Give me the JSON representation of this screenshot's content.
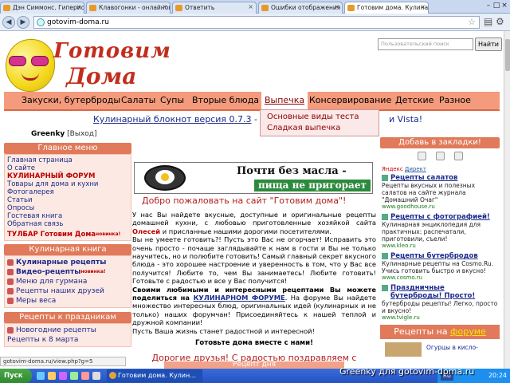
{
  "browser": {
    "tabs": [
      {
        "label": "Дэн Симмонс. Гиперион"
      },
      {
        "label": "Клавогонки - онлайновы"
      },
      {
        "label": "Ответить"
      },
      {
        "label": "Ошибки отображения са"
      },
      {
        "label": "Готовим дома. Кулинар"
      }
    ],
    "address": "gotovim-doma.ru",
    "status_url": "gotovim-doma.ru/view.php?g=5"
  },
  "site": {
    "logo_line1": "Готовим",
    "logo_line2": "Дома",
    "search_placeholder": "Пользовательский поиск",
    "search_button": "Найти",
    "nav": [
      {
        "label": "Закуски, бутерброды"
      },
      {
        "label": "Салаты"
      },
      {
        "label": "Супы"
      },
      {
        "label": "Вторые блюда"
      },
      {
        "label": "Выпечка"
      },
      {
        "label": "Консервирование"
      },
      {
        "label": "Детские"
      },
      {
        "label": "Разное"
      }
    ],
    "dropdown": [
      "Основные виды теста",
      "Сладкая выпечка"
    ],
    "notebook_text": "Кулинарный блокнот версия 0.7.3",
    "notebook_tail": "- co",
    "notebook_end": "и Vista!"
  },
  "left": {
    "username": "Greenky",
    "logout": "[Выход]",
    "main_menu_title": "Главное меню",
    "main_menu": [
      {
        "label": "Главная страница",
        "bold": false,
        "sup": ""
      },
      {
        "label": "О сайте",
        "bold": false,
        "sup": ""
      },
      {
        "label": "КУЛИНАРНЫЙ ФОРУМ",
        "bold": true,
        "sup": ""
      },
      {
        "label": "Товары для дома и кухни",
        "bold": false,
        "sup": ""
      },
      {
        "label": "Фотогалерея",
        "bold": false,
        "sup": ""
      },
      {
        "label": "Статьи",
        "bold": false,
        "sup": ""
      },
      {
        "label": "Опросы",
        "bold": false,
        "sup": ""
      },
      {
        "label": "Гостевая книга",
        "bold": false,
        "sup": ""
      },
      {
        "label": "Обратная связь",
        "bold": false,
        "sup": ""
      },
      {
        "label": "ТУЛБАР Готовим Дома",
        "bold": true,
        "sup": "новинка!"
      }
    ],
    "cookbook_title": "Кулинарная книга",
    "cookbook": [
      {
        "label": "Кулинарные рецепты",
        "bold": true,
        "sup": ""
      },
      {
        "label": "Видео-рецепты",
        "bold": true,
        "sup": "новинка!"
      },
      {
        "label": "Меню для гурмана",
        "bold": false,
        "sup": ""
      },
      {
        "label": "Рецепты наших друзей",
        "bold": false,
        "sup": ""
      },
      {
        "label": "Меры веса",
        "bold": false,
        "sup": ""
      }
    ],
    "holiday_title": "Рецепты к праздникам",
    "holiday": [
      {
        "label": "Новогодние рецепты"
      },
      {
        "label": "Рецепты к 8 марта"
      }
    ]
  },
  "center": {
    "banner_line1": "Почти без масла  -",
    "banner_line2": "пища не пригорает",
    "welcome": "Добро пожаловать на сайт \"Готовим дома\"!",
    "p1": "У нас Вы найдете вкусные, доступные и оригинальные рецепты домашней кухни, с любовью приготовленные хозяйкой сайта ",
    "olesya": "Олесей",
    "p1b": " и присланные нашими дорогими посетителями.",
    "p2": "Вы не умеете готовить?! Пусть это Вас не огорчает! Исправить это очень просто - почаще заглядывайте к нам в гости и Вы не только научитесь, но и полюбите готовить! Самый главный секрет вкусного блюда - это хорошее настроение и уверенность в том, что у Вас все получится! Любите то, чем Вы занимаетесь! Любите готовить! Готовьте с радостью и все у Вас получится!",
    "p3a": "Своими любимыми и интересными рецептами Вы можете поделиться на ",
    "forum_link": "КУЛИНАРНОМ ФОРУМЕ",
    "p3b": ". На форуме Вы найдете множество интересных блюд, оригинальных идей (кулинарных и не только) наших форумчан! Присоединяйтесь к нашей теплой и дружной компании!",
    "p4": "Пусть Ваша жизнь станет радостной и интересной!",
    "together": "Готовьте дома вместе с нами!",
    "greet": "Дорогие друзья! С радостью поздравляем с началом Успенского поста!",
    "recipe_day": "Рецепт дня"
  },
  "right": {
    "bookmarks_title": "Добавь в закладки!",
    "yandex_label": "Яндекс",
    "yandex_direct": "Директ",
    "ads": [
      {
        "title": "Рецепты салатов",
        "text": "Рецепты вкусных и полезных салатов на сайте журнала \"Домашний Очаг\"",
        "url": "www.goodhouse.ru"
      },
      {
        "title": "Рецепты с фотографией!",
        "text": "Кулинарная энциклопедия для практичных: распечатали, приготовили, съели!",
        "url": "www.kleo.ru"
      },
      {
        "title": "Рецепты бутербродов",
        "text": "Кулинарные рецепты на Cosmo.Ru. Учись готовить быстро и вкусно!",
        "url": "www.cosmo.ru"
      },
      {
        "title": "Праздничные бутерброды! Просто!",
        "text": "бутерброды рецепты! Легко, просто и вкусно!",
        "url": "www.tvigle.ru"
      }
    ],
    "forum_prefix": "Рецепты на ",
    "forum_word": "форуме",
    "forum_item": "Огурцы в кисло-"
  },
  "taskbar": {
    "start": "Пуск",
    "buttons": [
      {
        "label": "Готовим дома. Кулин..."
      }
    ],
    "lang": "RU",
    "clock": "20:24",
    "watermark": "Greenky для gotovim-doma.ru"
  }
}
